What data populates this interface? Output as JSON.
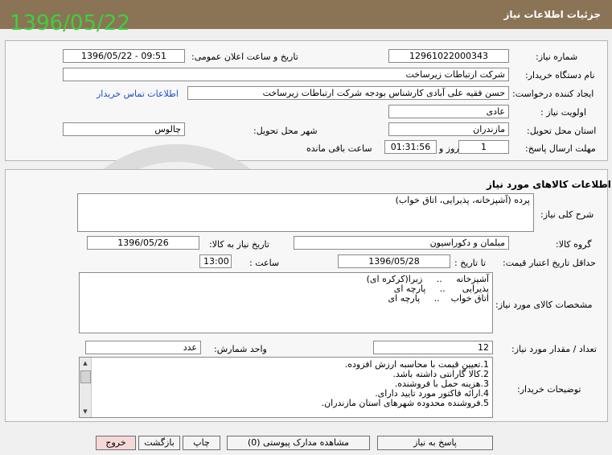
{
  "page": {
    "title": "جزئیات اطلاعات نیاز",
    "date_overlay": "1396/05/22"
  },
  "need": {
    "number_label": "شماره نیاز:",
    "number_value": "12961022000343",
    "announce_label": "تاریخ و ساعت اعلان عمومی:",
    "announce_value": "1396/05/22 - 09:51",
    "buyer_label": "نام دستگاه خریدار:",
    "buyer_value": "شرکت ارتباطات زیرساخت",
    "creator_label": "ایجاد کننده درخواست:",
    "creator_value": "حسن فقیه علی آبادی کارشناس بودجه شرکت ارتباطات زیرساخت",
    "contact_link": "اطلاعات تماس خریدار",
    "priority_label": "اولویت نیاز :",
    "priority_value": "عادی",
    "province_label": "استان محل تحویل:",
    "province_value": "مازندران",
    "city_label": "شهر محل تحویل:",
    "city_value": "چالوس",
    "deadline_label": "مهلت ارسال پاسخ:",
    "deadline_days": "1",
    "days_word": "روز و",
    "deadline_time": "01:31:56",
    "remaining_word": "ساعت باقی مانده"
  },
  "goods": {
    "section_title": "اطلاعات کالاهای مورد نیاز",
    "desc_label": "شرح کلی نیاز:",
    "desc_value": "پرده (آشپزخانه، پذیرایی، اتاق خواب)",
    "group_label": "گروه کالا:",
    "group_value": "مبلمان و دکوراسیون",
    "need_date_label": "تاریخ نیاز به کالا:",
    "need_date_value": "1396/05/26",
    "min_price_label": "حداقل تاریخ اعتبار قیمت:",
    "to_date_label": "تا تاریخ :",
    "to_date_value": "1396/05/28",
    "time_label": "ساعت :",
    "time_value": "13:00",
    "specs_label": "مشخصات کالای مورد نیاز:",
    "specs_lines": [
      "آشپزخانه     ..     زبرا(کرکره ای)",
      "پذیرایی      ..     پارچه ای",
      "اتاق خواب    ..     پارچه ای"
    ],
    "qty_label": "تعداد / مقدار مورد نیاز:",
    "qty_value": "12",
    "unit_label": "واحد شمارش:",
    "unit_value": "عدد",
    "buyer_notes_label": "توضیحات خریدار:",
    "buyer_notes": [
      "1.تعیین قیمت با محاسبه ارزش افزوده.",
      "2.کالا گارانتی داشته باشد.",
      "3.هزینه حمل با فروشنده.",
      "4.ارائه فاکتور مورد تایید دارای.",
      "5.فروشنده محدوده شهرهای استان مازندران."
    ]
  },
  "buttons": {
    "reply": "پاسخ به نیاز",
    "attachments": "مشاهده مدارک پیوستی (0)",
    "print": "چاپ",
    "back": "بازگشت",
    "exit": "خروج"
  }
}
